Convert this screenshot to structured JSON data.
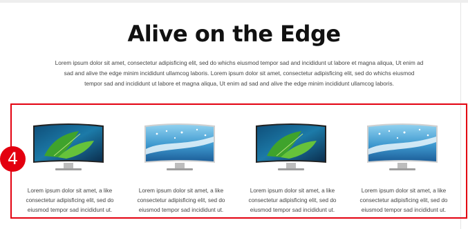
{
  "section": {
    "title": "Alive on the Edge",
    "intro_lines": [
      "Lorem ipsum dolor sit amet, consectetur adipisficing elit, sed do whichs eiusmod tempor sad and incididunt ut labore et magna aliqua, Ut enim ad",
      "sad and alive the edge minim incididunt ullamcog laboris. Lorem ipsum dolor sit amet, consectetur adipisficing elit, sed do whichs eiusmod",
      "tempor sad and incididunt ut labore et magna aliqua, Ut enim ad sad and alive the edge minim incididunt ullamcog laboris."
    ]
  },
  "annotation": {
    "marker": "4",
    "marker_color": "#e3000f"
  },
  "products": [
    {
      "image": "tv-green-leaf-screen",
      "desc_lines": [
        "Lorem ipsum dolor sit amet, a like",
        "consectetur adipisficing elit, sed do",
        "eiusmod tempor sad incididunt ut."
      ]
    },
    {
      "image": "tv-blue-wave-screen",
      "desc_lines": [
        "Lorem ipsum dolor sit amet, a like",
        "consectetur adipisficing elit, sed do",
        "eiusmod tempor sad incididunt ut."
      ]
    },
    {
      "image": "tv-green-leaf-screen",
      "desc_lines": [
        "Lorem ipsum dolor sit amet, a like",
        "consectetur adipisficing elit, sed do",
        "eiusmod tempor sad incididunt ut."
      ]
    },
    {
      "image": "tv-blue-wave-screen",
      "desc_lines": [
        "Lorem ipsum dolor sit amet, a like",
        "consectetur adipisficing elit, sed do",
        "eiusmod tempor sad incididunt ut."
      ]
    }
  ]
}
